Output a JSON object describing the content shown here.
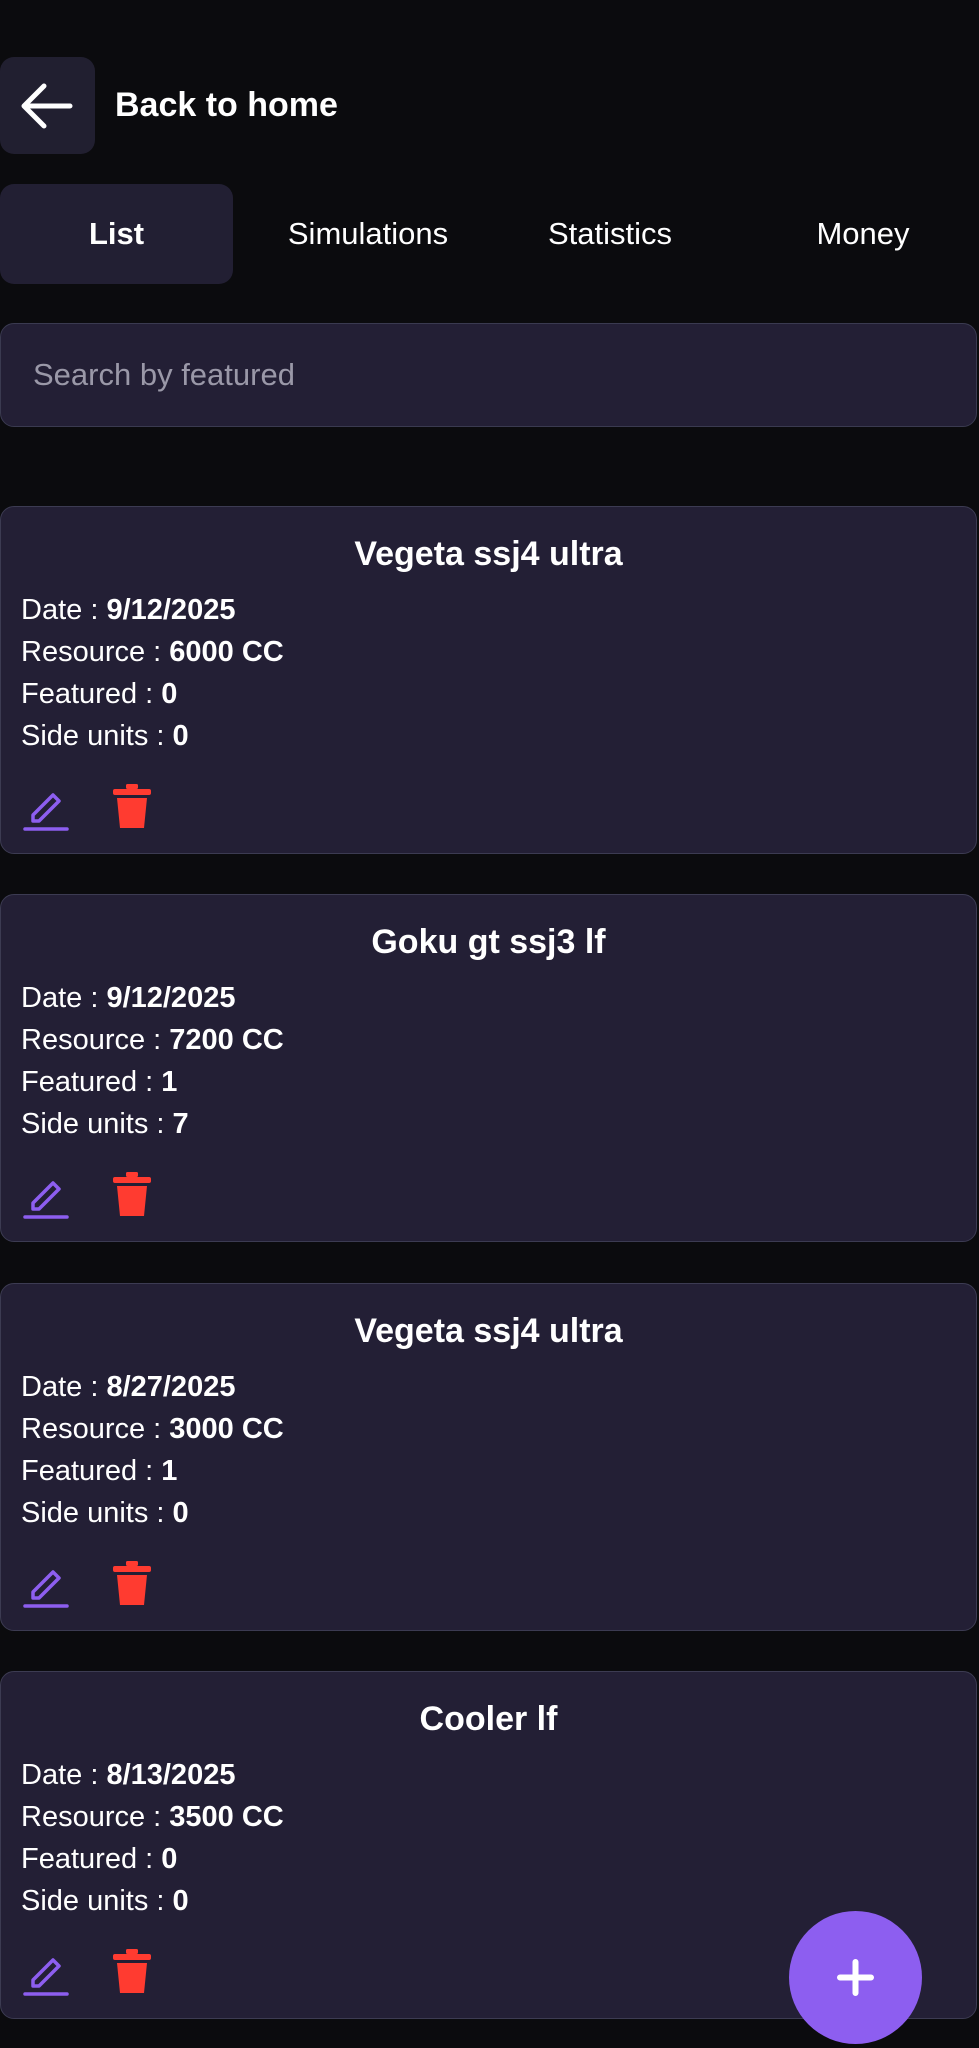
{
  "header": {
    "back_label": "Back to home"
  },
  "tabs": [
    {
      "label": "List",
      "active": true
    },
    {
      "label": "Simulations",
      "active": false
    },
    {
      "label": "Statistics",
      "active": false
    },
    {
      "label": "Money",
      "active": false
    }
  ],
  "search": {
    "placeholder": "Search by featured",
    "value": ""
  },
  "labels": {
    "date": "Date : ",
    "resource": "Resource : ",
    "featured": "Featured : ",
    "side_units": "Side units : "
  },
  "cards": [
    {
      "title": "Vegeta ssj4 ultra",
      "date": "9/12/2025",
      "resource": "6000 CC",
      "featured": "0",
      "side_units": "0"
    },
    {
      "title": "Goku gt ssj3 lf",
      "date": "9/12/2025",
      "resource": "7200 CC",
      "featured": "1",
      "side_units": "7"
    },
    {
      "title": "Vegeta ssj4 ultra",
      "date": "8/27/2025",
      "resource": "3000 CC",
      "featured": "1",
      "side_units": "0"
    },
    {
      "title": "Cooler lf",
      "date": "8/13/2025",
      "resource": "3500 CC",
      "featured": "0",
      "side_units": "0"
    }
  ],
  "icons": {
    "back": "arrow-left-icon",
    "edit": "pencil-icon",
    "delete": "trash-icon",
    "add": "plus-icon"
  },
  "colors": {
    "accent": "#8d5ef0",
    "delete": "#ff3b30",
    "card_bg": "#231f35",
    "page_bg": "#0b0b0e"
  }
}
